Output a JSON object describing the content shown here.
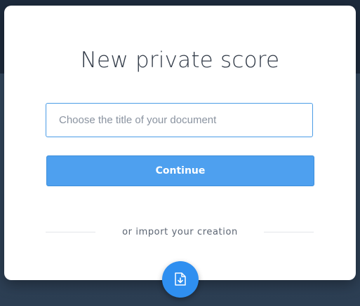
{
  "modal": {
    "title": "New private score",
    "title_input": {
      "placeholder": "Choose the title of your document",
      "value": ""
    },
    "continue_label": "Continue",
    "import_label": "or import your creation",
    "import_icon": "file-import-icon"
  },
  "colors": {
    "accent": "#4ea0ef",
    "import_button": "#2f8ff0",
    "title_text": "#313a47",
    "input_border": "#4a9ce6"
  }
}
